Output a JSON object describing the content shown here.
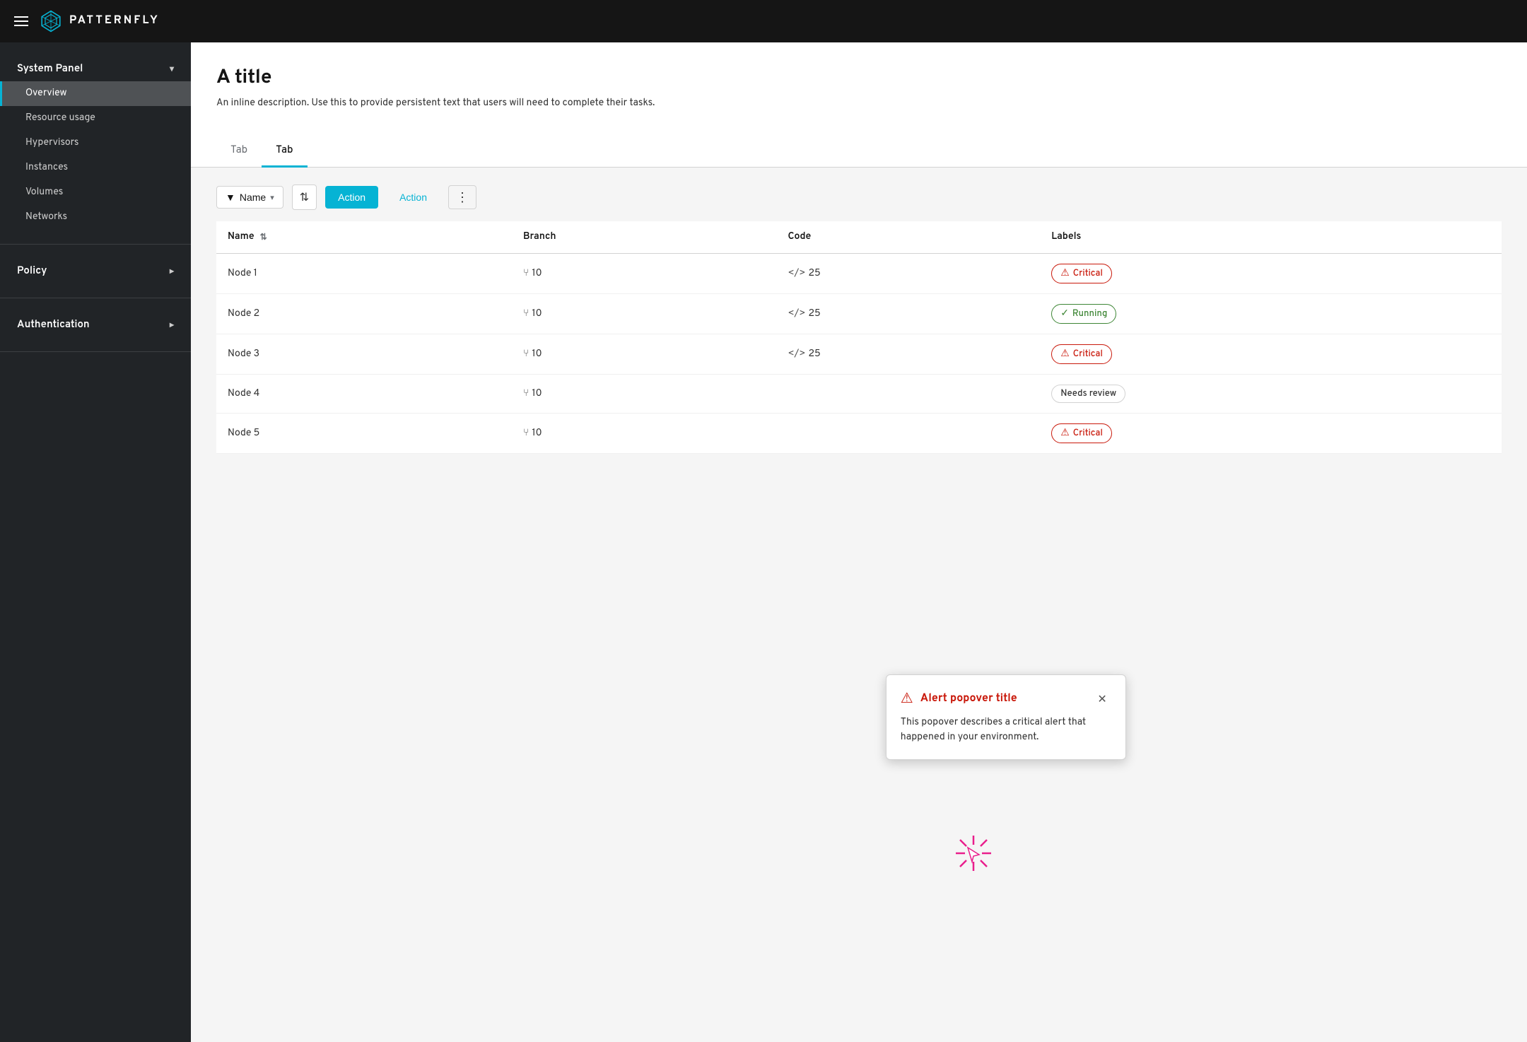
{
  "topnav": {
    "brand_name": "PATTERNFLY"
  },
  "sidebar": {
    "system_panel_label": "System Panel",
    "items": [
      {
        "id": "overview",
        "label": "Overview",
        "active": true
      },
      {
        "id": "resource-usage",
        "label": "Resource usage",
        "active": false
      },
      {
        "id": "hypervisors",
        "label": "Hypervisors",
        "active": false
      },
      {
        "id": "instances",
        "label": "Instances",
        "active": false
      },
      {
        "id": "volumes",
        "label": "Volumes",
        "active": false
      },
      {
        "id": "networks",
        "label": "Networks",
        "active": false
      }
    ],
    "policy_label": "Policy",
    "authentication_label": "Authentication"
  },
  "page": {
    "title": "A title",
    "description": "An inline description. Use this to provide persistent text that users will need to complete their tasks."
  },
  "tabs": [
    {
      "id": "tab1",
      "label": "Tab",
      "active": false
    },
    {
      "id": "tab2",
      "label": "Tab",
      "active": true
    }
  ],
  "toolbar": {
    "filter_label": "Name",
    "action_primary_label": "Action",
    "action_link_label": "Action"
  },
  "table": {
    "columns": [
      {
        "id": "name",
        "label": "Name",
        "sortable": true
      },
      {
        "id": "branch",
        "label": "Branch"
      },
      {
        "id": "code",
        "label": "Code"
      },
      {
        "id": "labels",
        "label": "Labels"
      }
    ],
    "rows": [
      {
        "name": "Node 1",
        "branch": "10",
        "code": "25",
        "label": "Critical",
        "label_type": "critical"
      },
      {
        "name": "Node 2",
        "branch": "10",
        "code": "25",
        "label": "Running",
        "label_type": "running"
      },
      {
        "name": "Node 3",
        "branch": "10",
        "code": "25",
        "label": "Critical",
        "label_type": "critical"
      },
      {
        "name": "Node 4",
        "branch": "10",
        "code": "",
        "label": "Needs review",
        "label_type": "review"
      },
      {
        "name": "Node 5",
        "branch": "10",
        "code": "",
        "label": "Critical",
        "label_type": "critical"
      }
    ]
  },
  "popover": {
    "title": "Alert popover title",
    "body": "This popover describes a critical alert that happened in your environment."
  }
}
